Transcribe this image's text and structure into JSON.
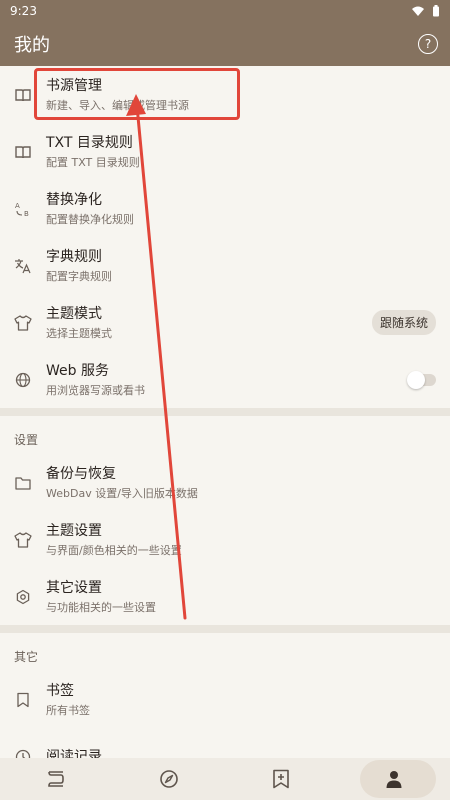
{
  "status": {
    "time": "9:23"
  },
  "app_bar": {
    "title": "我的",
    "help_icon": "help-circle-icon"
  },
  "top_items": [
    {
      "title": "书源管理",
      "subtitle": "新建、导入、编辑或管理书源",
      "icon": "book-open-icon"
    },
    {
      "title": "TXT 目录规则",
      "subtitle": "配置 TXT 目录规则",
      "icon": "book-open-icon"
    },
    {
      "title": "替换净化",
      "subtitle": "配置替换净化规则",
      "icon": "replace-icon"
    },
    {
      "title": "字典规则",
      "subtitle": "配置字典规则",
      "icon": "translate-icon"
    },
    {
      "title": "主题模式",
      "subtitle": "选择主题模式",
      "icon": "shirt-icon",
      "value": "跟随系统"
    },
    {
      "title": "Web 服务",
      "subtitle": "用浏览器写源或看书",
      "icon": "globe-icon",
      "toggle": "off"
    }
  ],
  "settings": {
    "header": "设置",
    "items": [
      {
        "title": "备份与恢复",
        "subtitle": "WebDav 设置/导入旧版本数据",
        "icon": "folder-icon"
      },
      {
        "title": "主题设置",
        "subtitle": "与界面/颜色相关的一些设置",
        "icon": "shirt-icon"
      },
      {
        "title": "其它设置",
        "subtitle": "与功能相关的一些设置",
        "icon": "gear-icon"
      }
    ]
  },
  "others": {
    "header": "其它",
    "items": [
      {
        "title": "书签",
        "subtitle": "所有书签",
        "icon": "bookmark-icon"
      },
      {
        "title": "阅读记录",
        "subtitle": "",
        "icon": "clock-icon"
      }
    ]
  },
  "bottom_nav": [
    {
      "name": "bookshelf",
      "icon": "bookshelf-icon"
    },
    {
      "name": "discover",
      "icon": "compass-icon"
    },
    {
      "name": "rss",
      "icon": "bookmark-add-icon"
    },
    {
      "name": "my",
      "icon": "person-icon",
      "active": true
    }
  ],
  "accent_colors": {
    "app_bar": "#85725f",
    "annotation": "#e1463a"
  }
}
